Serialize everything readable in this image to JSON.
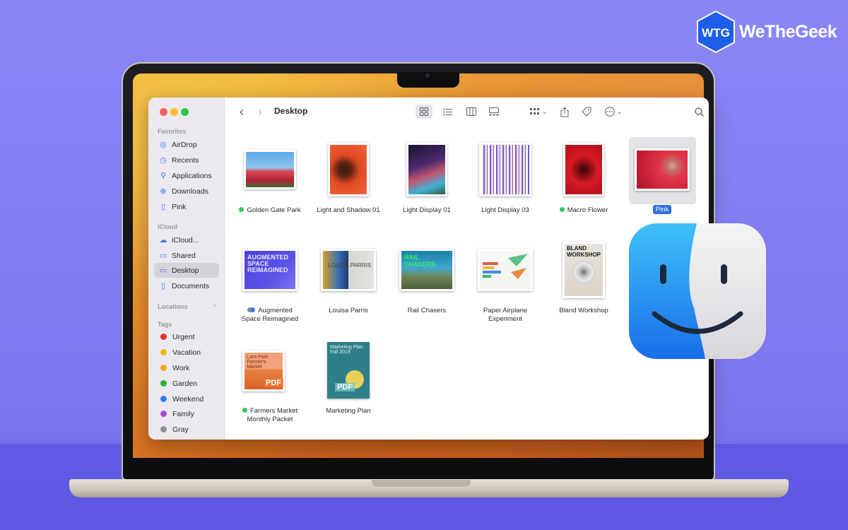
{
  "brand": {
    "name": "WeTheGeek",
    "monogram": "WTG",
    "color": "#1e5ee8"
  },
  "window": {
    "title": "Desktop",
    "traffic_lights": [
      "#ff5f57",
      "#febc2e",
      "#28c840"
    ]
  },
  "sidebar": {
    "favorites_label": "Favorites",
    "favorites": [
      {
        "label": "AirDrop",
        "icon": "airdrop-icon"
      },
      {
        "label": "Recents",
        "icon": "clock-icon"
      },
      {
        "label": "Applications",
        "icon": "applications-icon"
      },
      {
        "label": "Downloads",
        "icon": "download-icon"
      },
      {
        "label": "Pink",
        "icon": "document-icon"
      }
    ],
    "icloud_label": "iCloud",
    "icloud": [
      {
        "label": "iCloud...",
        "icon": "cloud-icon"
      },
      {
        "label": "Shared",
        "icon": "shared-folder-icon"
      },
      {
        "label": "Desktop",
        "icon": "desktop-icon",
        "active": true
      },
      {
        "label": "Documents",
        "icon": "document-icon"
      }
    ],
    "locations_label": "Locations",
    "tags_label": "Tags",
    "tags": [
      {
        "label": "Urgent",
        "color": "#e8322b"
      },
      {
        "label": "Vacation",
        "color": "#f5b40f"
      },
      {
        "label": "Work",
        "color": "#f0a81a"
      },
      {
        "label": "Garden",
        "color": "#2bb33a"
      },
      {
        "label": "Weekend",
        "color": "#2f7ce8"
      },
      {
        "label": "Family",
        "color": "#a64bd6"
      },
      {
        "label": "Gray",
        "color": "#8e8e93"
      }
    ]
  },
  "toolbar": {
    "icons": [
      "back-icon",
      "forward-icon",
      "icon-view-icon",
      "list-view-icon",
      "column-view-icon",
      "gallery-view-icon",
      "group-icon",
      "share-icon",
      "tag-icon",
      "more-icon",
      "search-icon"
    ]
  },
  "files": [
    {
      "name": "Golden Gate Park",
      "tag": "#34c759"
    },
    {
      "name": "Light and Shadow 01"
    },
    {
      "name": "Light Display 01"
    },
    {
      "name": "Light Display 03"
    },
    {
      "name": "Macro Flower",
      "tag": "#34c759"
    },
    {
      "name": "Pink",
      "selected": true
    },
    {
      "name_line1": "Augmented",
      "name_line2": "Space Reimagined",
      "tags": [
        "#8e8e93",
        "#2f7ce8"
      ]
    },
    {
      "name": "Louisa Parris"
    },
    {
      "name": "Rail Chasers"
    },
    {
      "name_line1": "Paper Airplane",
      "name_line2": "Experiment"
    },
    {
      "name": "Bland Workshop"
    },
    {
      "name_line1": "Farmers Market",
      "name_line2": "Monthly Packet",
      "tag": "#34c759"
    },
    {
      "name": "Marketing Plan"
    }
  ],
  "thumb_text": {
    "augmented": "AUGMENTED SPACE REIMAGINED",
    "louisa": "LOUISA PARRIS",
    "rail": "RAIL CHASERS",
    "bland": "BLAND WORKSHOP",
    "farmers": "Lara Park Farmer's Market",
    "marketing": "Marketing Plan Fall 2019",
    "pdf": "PDF"
  }
}
